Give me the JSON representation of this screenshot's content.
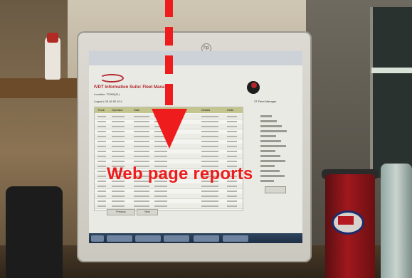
{
  "annotation": {
    "label": "Web page reports",
    "color": "#ee1c1c"
  },
  "screen": {
    "site_title": "IVDT Information Suite: Fleet Mana",
    "location": "Location: TOWN(11)",
    "logout": "Logout | 05.16.90 10:1",
    "user": "3T Fleet Manager",
    "table_headers": [
      "Truck",
      "Operator",
      "Date",
      "Time",
      "Details",
      "Units"
    ],
    "prev_button": "Previous",
    "next_button": "Next"
  },
  "monitor": {
    "brand": "hp"
  }
}
